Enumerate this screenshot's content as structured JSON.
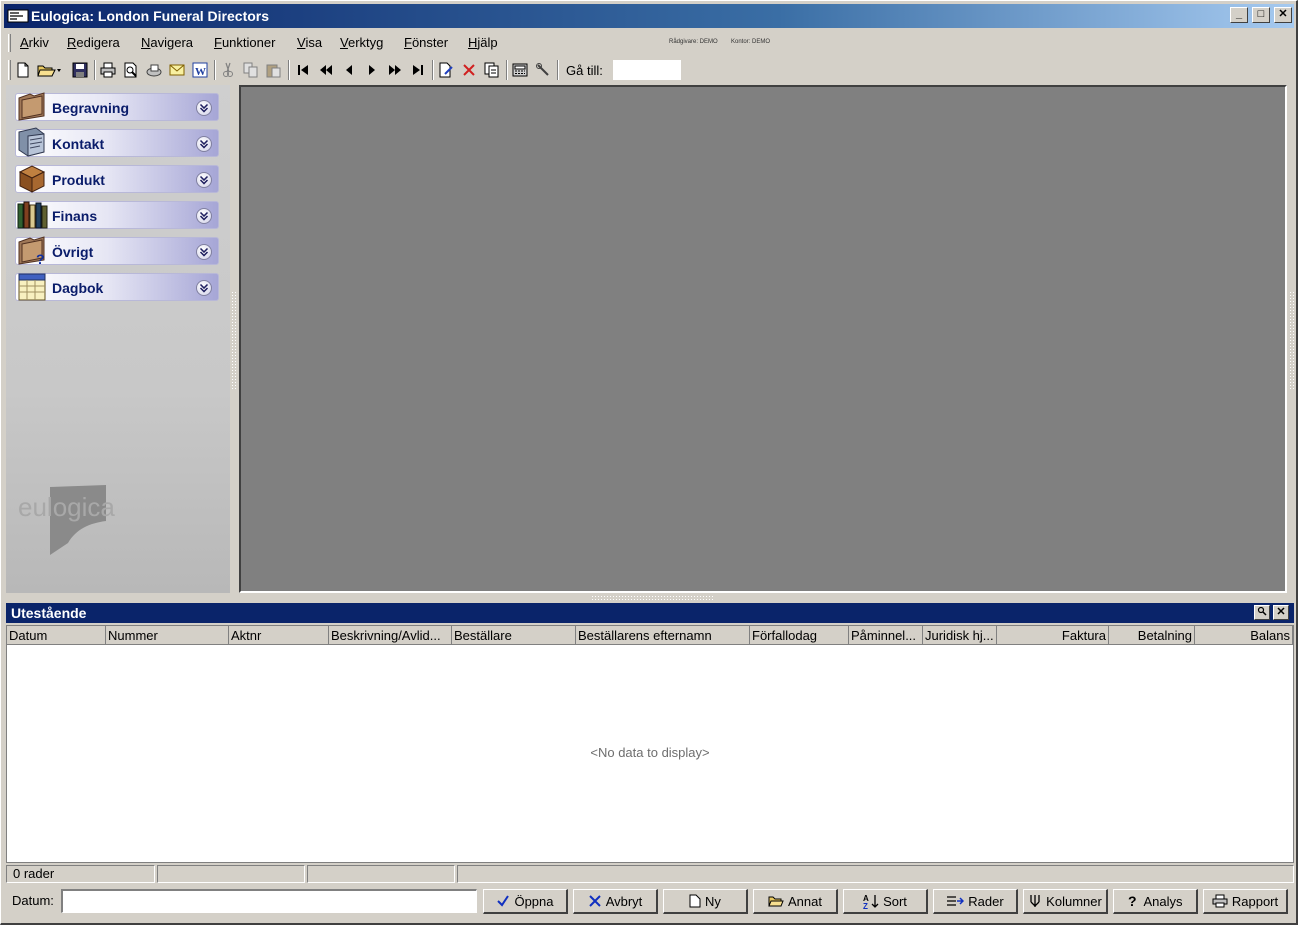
{
  "window": {
    "title": "Eulogica: London Funeral Directors",
    "min_symbol": "_",
    "max_symbol": "□",
    "close_symbol": "✕"
  },
  "menu": {
    "items": [
      {
        "label": "Arkiv",
        "accel": "A"
      },
      {
        "label": "Redigera",
        "accel": "R"
      },
      {
        "label": "Navigera",
        "accel": "N"
      },
      {
        "label": "Funktioner",
        "accel": "F"
      },
      {
        "label": "Visa",
        "accel": "V"
      },
      {
        "label": "Verktyg",
        "accel": "V"
      },
      {
        "label": "Fönster",
        "accel": "F"
      },
      {
        "label": "Hjälp",
        "accel": "H"
      }
    ],
    "info_advisor": "Rådgivare: DEMO",
    "info_office": "Kontor: DEMO"
  },
  "toolbar": {
    "goto_label": "Gå till:",
    "goto_value": ""
  },
  "sidebar": {
    "items": [
      {
        "label": "Begravning",
        "icon": "folder-icon"
      },
      {
        "label": "Kontakt",
        "icon": "contact-card-icon"
      },
      {
        "label": "Produkt",
        "icon": "box-icon"
      },
      {
        "label": "Finans",
        "icon": "books-icon"
      },
      {
        "label": "Övrigt",
        "icon": "folder-question-icon"
      },
      {
        "label": "Dagbok",
        "icon": "calendar-icon"
      }
    ],
    "logo_text": "eulogica"
  },
  "panel": {
    "title": "Utestående",
    "columns": [
      {
        "label": "Datum",
        "align": "left"
      },
      {
        "label": "Nummer",
        "align": "left"
      },
      {
        "label": "Aktnr",
        "align": "left"
      },
      {
        "label": "Beskrivning/Avlid...",
        "align": "left"
      },
      {
        "label": "Beställare",
        "align": "left"
      },
      {
        "label": "Beställarens efternamn",
        "align": "left"
      },
      {
        "label": "Förfallodag",
        "align": "left"
      },
      {
        "label": "Påminnel...",
        "align": "left"
      },
      {
        "label": "Juridisk hj...",
        "align": "left"
      },
      {
        "label": "Faktura",
        "align": "right"
      },
      {
        "label": "Betalning",
        "align": "right"
      },
      {
        "label": "Balans",
        "align": "right"
      }
    ],
    "rows": [],
    "empty_text": "<No data to display>"
  },
  "status": {
    "rows_label": "0 rader"
  },
  "bottom": {
    "date_label": "Datum:",
    "date_value": "",
    "buttons": [
      {
        "label": "Öppna",
        "icon": "checkmark-icon"
      },
      {
        "label": "Avbryt",
        "icon": "cross-icon"
      },
      {
        "label": "Ny",
        "icon": "new-document-icon"
      },
      {
        "label": "Annat",
        "icon": "open-folder-icon"
      },
      {
        "label": "Sort",
        "icon": "sort-az-icon"
      },
      {
        "label": "Rader",
        "icon": "rows-icon"
      },
      {
        "label": "Kolumner",
        "icon": "columns-icon"
      },
      {
        "label": "Analys",
        "icon": "question-icon"
      },
      {
        "label": "Rapport",
        "icon": "printer-icon"
      }
    ]
  },
  "colors": {
    "titlebar_start": "#0a246a",
    "titlebar_end": "#a6caf0",
    "window_bg": "#d4d0c8",
    "workspace_bg": "#808080",
    "nav_text": "#0a1c6a"
  }
}
